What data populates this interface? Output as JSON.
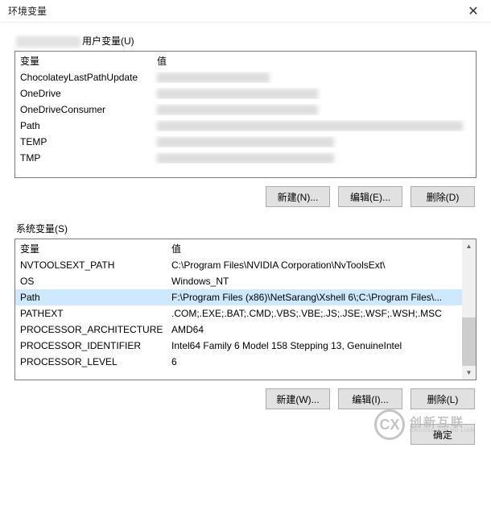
{
  "window": {
    "title": "环境变量",
    "close_glyph": "✕"
  },
  "user_section": {
    "label_suffix": "用户变量(U)",
    "headers": {
      "variable": "变量",
      "value": "值"
    },
    "rows": [
      {
        "name": "ChocolateyLastPathUpdate",
        "value_blurred": true,
        "bw": 140
      },
      {
        "name": "OneDrive",
        "value_blurred": true,
        "bw": 200
      },
      {
        "name": "OneDriveConsumer",
        "value_blurred": true,
        "bw": 200
      },
      {
        "name": "Path",
        "value_blurred": true,
        "bw": 380
      },
      {
        "name": "TEMP",
        "value_blurred": true,
        "bw": 220
      },
      {
        "name": "TMP",
        "value_blurred": true,
        "bw": 220
      }
    ],
    "buttons": {
      "new": "新建(N)...",
      "edit": "编辑(E)...",
      "delete": "删除(D)"
    }
  },
  "system_section": {
    "label": "系统变量(S)",
    "headers": {
      "variable": "变量",
      "value": "值"
    },
    "rows": [
      {
        "name": "NVTOOLSEXT_PATH",
        "value": "C:\\Program Files\\NVIDIA Corporation\\NvToolsExt\\",
        "selected": false
      },
      {
        "name": "OS",
        "value": "Windows_NT",
        "selected": false
      },
      {
        "name": "Path",
        "value": "F:\\Program Files (x86)\\NetSarang\\Xshell 6\\;C:\\Program Files\\...",
        "selected": true
      },
      {
        "name": "PATHEXT",
        "value": ".COM;.EXE;.BAT;.CMD;.VBS;.VBE;.JS;.JSE;.WSF;.WSH;.MSC",
        "selected": false
      },
      {
        "name": "PROCESSOR_ARCHITECTURE",
        "value": "AMD64",
        "selected": false
      },
      {
        "name": "PROCESSOR_IDENTIFIER",
        "value": "Intel64 Family 6 Model 158 Stepping 13, GenuineIntel",
        "selected": false
      },
      {
        "name": "PROCESSOR_LEVEL",
        "value": "6",
        "selected": false
      }
    ],
    "buttons": {
      "new": "新建(W)...",
      "edit": "编辑(I)...",
      "delete": "删除(L)"
    },
    "scroll": {
      "up": "▲",
      "down": "▼"
    }
  },
  "footer": {
    "ok": "确定"
  },
  "watermark": {
    "glyph": "CX",
    "cn": "创新互联",
    "en": "CHUANG XIN HU LIAN"
  }
}
